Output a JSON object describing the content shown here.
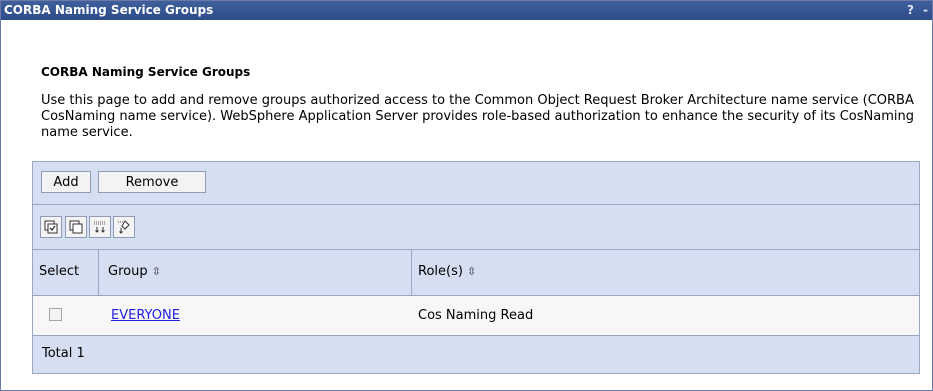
{
  "window": {
    "title": "CORBA Naming Service Groups",
    "help": "?",
    "minimize": "-"
  },
  "page": {
    "heading": "CORBA Naming Service Groups",
    "description": "Use this page to add and remove groups authorized access to the Common Object Request Broker Architecture name service (CORBA CosNaming name service). WebSphere Application Server provides role-based authorization to enhance the security of its CosNaming name service."
  },
  "toolbar": {
    "add_label": "Add",
    "remove_label": "Remove"
  },
  "icons": [
    "select-all-icon",
    "deselect-all-icon",
    "show-filter-icon",
    "clear-filter-icon"
  ],
  "table": {
    "columns": {
      "select": "Select",
      "group": "Group",
      "role": "Role(s)",
      "sort_glyph": "⇳"
    },
    "rows": [
      {
        "group": "EVERYONE",
        "role": "Cos Naming Read",
        "checked": false
      }
    ],
    "total": "Total 1"
  },
  "colors": {
    "titlebar": "#2e4c8a",
    "table_header": "#d6dff2",
    "link": "#2020e0"
  }
}
